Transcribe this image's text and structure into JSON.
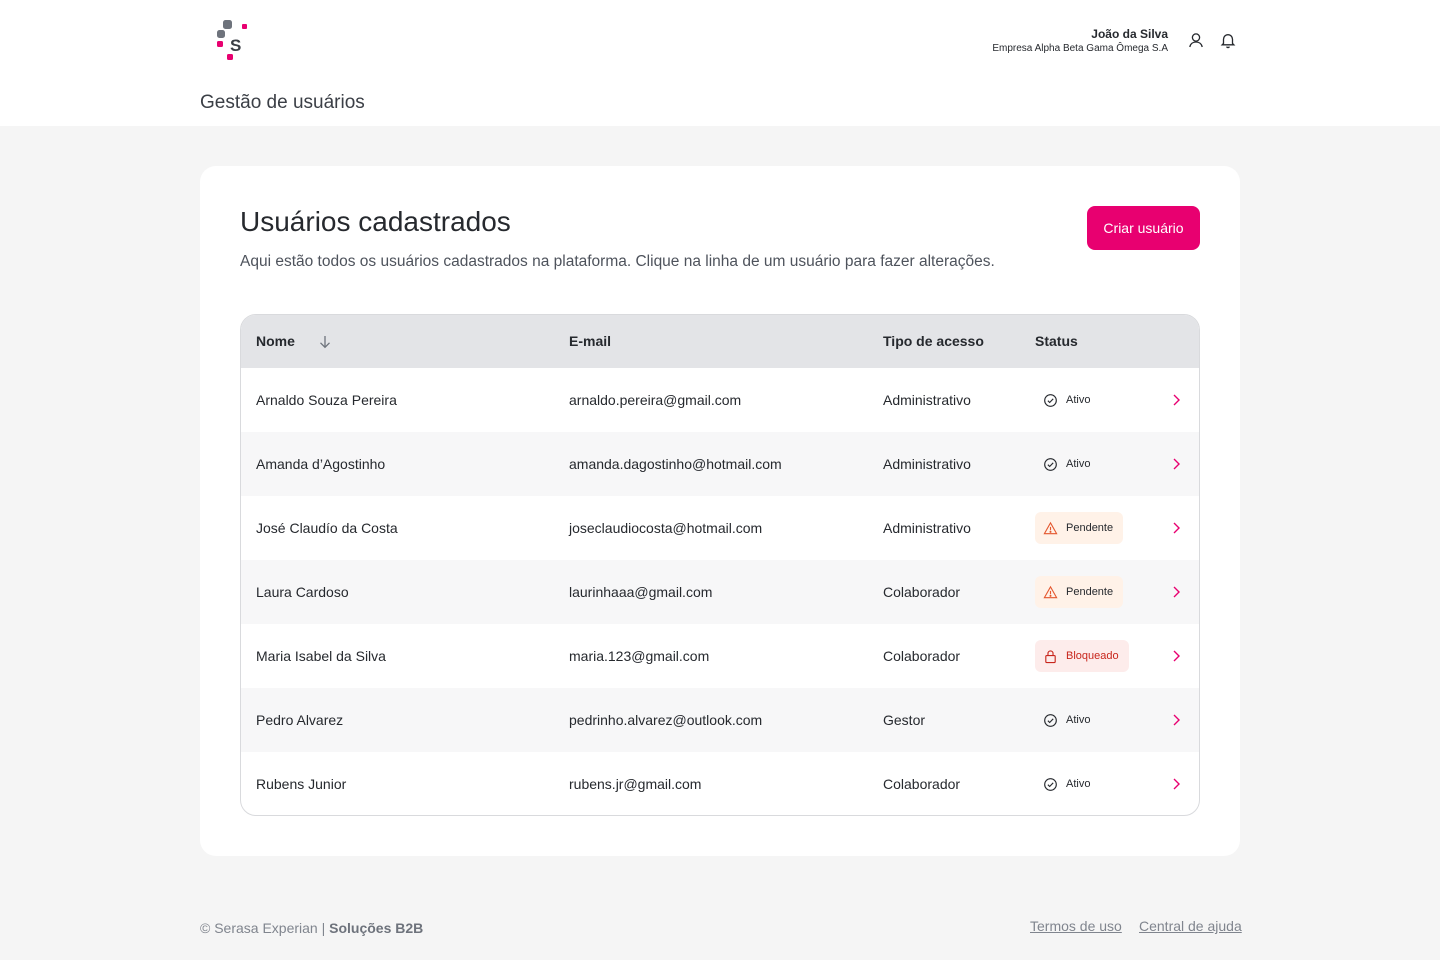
{
  "header": {
    "user_name": "João da Silva",
    "company": "Empresa Alpha Beta Gama Ômega S.A",
    "page_title": "Gestão de usuários"
  },
  "card": {
    "title": "Usuários cadastrados",
    "subtitle": "Aqui estão todos os usuários cadastrados na plataforma. Clique na linha de um usuário para fazer alterações.",
    "create_button": "Criar usuário"
  },
  "table": {
    "columns": [
      "Nome",
      "E-mail",
      "Tipo de acesso",
      "Status"
    ],
    "sort": {
      "column": "Nome",
      "direction": "descending"
    },
    "rows": [
      {
        "name": "Arnaldo Souza Pereira",
        "email": "arnaldo.pereira@gmail.com",
        "access": "Administrativo",
        "status": "Ativo",
        "status_kind": "active"
      },
      {
        "name": "Amanda d’Agostinho",
        "email": "amanda.dagostinho@hotmail.com",
        "access": "Administrativo",
        "status": "Ativo",
        "status_kind": "active"
      },
      {
        "name": "José Claudío da Costa",
        "email": "joseclaudiocosta@hotmail.com",
        "access": "Administrativo",
        "status": "Pendente",
        "status_kind": "pending"
      },
      {
        "name": "Laura Cardoso",
        "email": "laurinhaaa@gmail.com",
        "access": "Colaborador",
        "status": "Pendente",
        "status_kind": "pending"
      },
      {
        "name": "Maria Isabel da Silva",
        "email": "maria.123@gmail.com",
        "access": "Colaborador",
        "status": "Bloqueado",
        "status_kind": "blocked"
      },
      {
        "name": "Pedro Alvarez",
        "email": "pedrinho.alvarez@outlook.com",
        "access": "Gestor",
        "status": "Ativo",
        "status_kind": "active"
      },
      {
        "name": "Rubens Junior",
        "email": "rubens.jr@gmail.com",
        "access": "Colaborador",
        "status": "Ativo",
        "status_kind": "active"
      }
    ]
  },
  "footer": {
    "copyright": "© Serasa Experian |",
    "brand": "Soluções B2B",
    "terms": "Termos de uso",
    "help": "Central de ajuda"
  },
  "colors": {
    "accent": "#e80070",
    "pending": "#e4572e",
    "blocked": "#c8261c",
    "background": "#f5f5f5"
  },
  "icons": {
    "header": [
      "user-icon",
      "bell-icon"
    ],
    "sort": "arrow-down-icon",
    "row_action": "chevron-right-icon",
    "status": {
      "active": "check-circle-icon",
      "pending": "warning-triangle-icon",
      "blocked": "lock-icon"
    }
  }
}
